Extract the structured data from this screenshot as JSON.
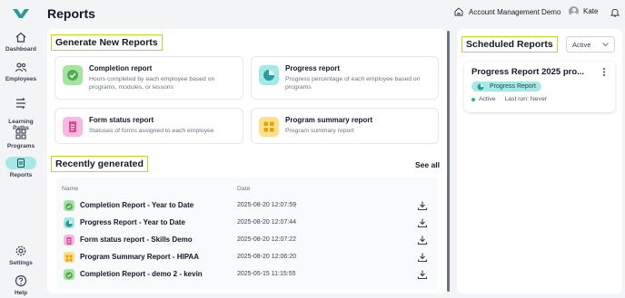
{
  "app": {
    "title": "Reports"
  },
  "header": {
    "organization": "Account Management Demo",
    "user": "Kate"
  },
  "sidebar": {
    "items": [
      {
        "label": "Dashboard",
        "icon": "home-icon"
      },
      {
        "label": "Employees",
        "icon": "users-icon"
      },
      {
        "label": "Learning\nPaths",
        "icon": "paths-icon"
      },
      {
        "label": "Programs",
        "icon": "grid-icon"
      },
      {
        "label": "Reports",
        "icon": "report-icon",
        "active": true
      },
      {
        "label": "Settings",
        "icon": "gear-icon"
      },
      {
        "label": "Help",
        "icon": "help-icon"
      }
    ]
  },
  "generate": {
    "title": "Generate New Reports",
    "cards": [
      {
        "title": "Completion report",
        "desc": "Hours completed by each employee based on programs, modules, or lessons",
        "color": "#a7e3a1"
      },
      {
        "title": "Progress report",
        "desc": "Progress percentage of each employee based on programs",
        "color": "#a7e8e6"
      },
      {
        "title": "Form status report",
        "desc": "Statuses of forms assigned to each employee",
        "color": "#f9b8e0"
      },
      {
        "title": "Program summary report",
        "desc": "Program summary report",
        "color": "#fde08a"
      }
    ]
  },
  "recent": {
    "title": "Recently generated",
    "see_all": "See all",
    "col_name": "Name",
    "col_date": "Date",
    "rows": [
      {
        "name": "Completion Report - Year to Date",
        "date": "2025-08-20 12:07:59",
        "color": "#a7e3a1",
        "icon": "check-icon"
      },
      {
        "name": "Progress Report - Year to Date",
        "date": "2025-08-20 12:07:44",
        "color": "#a7e8e6",
        "icon": "pie-icon"
      },
      {
        "name": "Form status report - Skills Demo",
        "date": "2025-08-20 12:07:22",
        "color": "#f9b8e0",
        "icon": "form-icon"
      },
      {
        "name": "Program Summary Report - HIPAA",
        "date": "2025-08-20 12:06:20",
        "color": "#fde08a",
        "icon": "grid-icon"
      },
      {
        "name": "Completion Report - demo 2 - kevin",
        "date": "2025-05-15 11:15:55",
        "color": "#a7e3a1",
        "icon": "check-icon"
      }
    ]
  },
  "scheduled": {
    "title": "Scheduled Reports",
    "filter": "Active",
    "card": {
      "title": "Progress Report 2025 pro...",
      "badge": "Progress Report",
      "status": "Active",
      "last_run": "Last run: Never"
    }
  }
}
